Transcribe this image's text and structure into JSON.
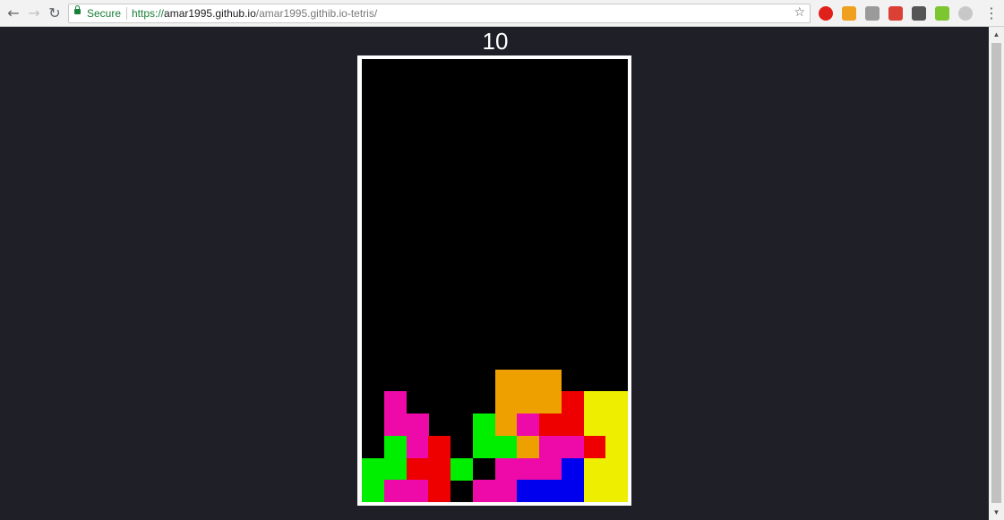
{
  "browser": {
    "back_icon": "arrow-left-icon",
    "forward_icon": "arrow-right-icon",
    "reload_icon": "reload-icon",
    "secure_label": "Secure",
    "url_scheme": "https://",
    "url_host": "amar1995.github.io",
    "url_path": "/amar1995.githib.io-tetris/",
    "bookmark_icon": "star-icon",
    "menu_icon": "kebab-menu-icon",
    "extensions": [
      {
        "name": "opera-icon",
        "color": "#e0201b"
      },
      {
        "name": "carrot-icon",
        "color": "#f0a020"
      },
      {
        "name": "cloud-icon",
        "color": "#9a9a9a"
      },
      {
        "name": "todoist-icon",
        "color": "#db4035"
      },
      {
        "name": "eyedropper-icon",
        "color": "#555555"
      },
      {
        "name": "green-hex-icon",
        "color": "#7cc62f"
      },
      {
        "name": "grey-circle-icon",
        "color": "#c8c8c8"
      }
    ]
  },
  "game": {
    "score": "10",
    "colors": {
      "G": "#00ee00",
      "M": "#ee0aa9",
      "R": "#ee0000",
      "O": "#eea000",
      "B": "#0000ee",
      "Y": "#eeee00"
    },
    "columns": 12,
    "rows": 20,
    "board_rows": [
      "............",
      "............",
      "............",
      "............",
      "............",
      "............",
      "............",
      "............",
      "............",
      "............",
      "............",
      "............",
      "............",
      "............",
      "......OOO...",
      ".M....OOORYY",
      ".MM..GOMRRYY",
      ".GMR.GGOMMRYY",
      "GGRRG.MMMBYY",
      "GMMR.MMBBBYY"
    ]
  }
}
